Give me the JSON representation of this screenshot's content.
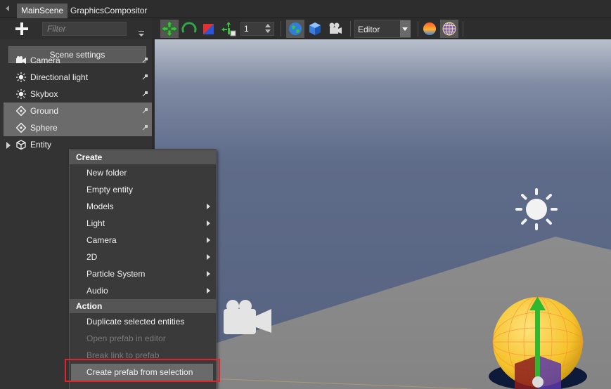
{
  "tabs": [
    {
      "label": "MainScene",
      "active": true
    },
    {
      "label": "GraphicsCompositor",
      "active": false
    }
  ],
  "left_panel": {
    "filter_placeholder": "Filter",
    "scene_settings_label": "Scene settings",
    "tree": [
      {
        "label": "Camera",
        "icon": "camera-icon",
        "selected": false
      },
      {
        "label": "Directional light",
        "icon": "sun-icon",
        "selected": false
      },
      {
        "label": "Skybox",
        "icon": "sun-icon",
        "selected": false
      },
      {
        "label": "Ground",
        "icon": "diamond-icon",
        "selected": true
      },
      {
        "label": "Sphere",
        "icon": "diamond-icon",
        "selected": true
      },
      {
        "label": "Entity",
        "icon": "cube-icon",
        "selected": false,
        "expandable": true
      }
    ]
  },
  "viewport_toolbar": {
    "step_value": "1",
    "mode_label": "Editor",
    "buttons": [
      "translate-gizmo-icon",
      "rotate-gizmo-icon",
      "scale-gizmo-icon",
      "snap-icon",
      "world-space-icon",
      "local-space-icon",
      "camera-settings-icon",
      "lighting-icon",
      "wireframe-icon"
    ]
  },
  "context_menu": {
    "sections": [
      {
        "header": "Create",
        "items": [
          {
            "label": "New folder",
            "submenu": false,
            "enabled": true
          },
          {
            "label": "Empty entity",
            "submenu": false,
            "enabled": true
          },
          {
            "label": "Models",
            "submenu": true,
            "enabled": true
          },
          {
            "label": "Light",
            "submenu": true,
            "enabled": true
          },
          {
            "label": "Camera",
            "submenu": true,
            "enabled": true
          },
          {
            "label": "2D",
            "submenu": true,
            "enabled": true
          },
          {
            "label": "Particle System",
            "submenu": true,
            "enabled": true
          },
          {
            "label": "Audio",
            "submenu": true,
            "enabled": true
          }
        ]
      },
      {
        "header": "Action",
        "items": [
          {
            "label": "Duplicate selected entities",
            "submenu": false,
            "enabled": true
          },
          {
            "label": "Open prefab in editor",
            "submenu": false,
            "enabled": false
          },
          {
            "label": "Break link to prefab",
            "submenu": false,
            "enabled": false
          },
          {
            "label": "Create prefab from selection",
            "submenu": false,
            "enabled": true,
            "highlighted": true
          }
        ]
      }
    ]
  },
  "colors": {
    "highlight_box": "#e0242a",
    "sky_top": "#5a6786",
    "ground": "#8a8a8a"
  }
}
